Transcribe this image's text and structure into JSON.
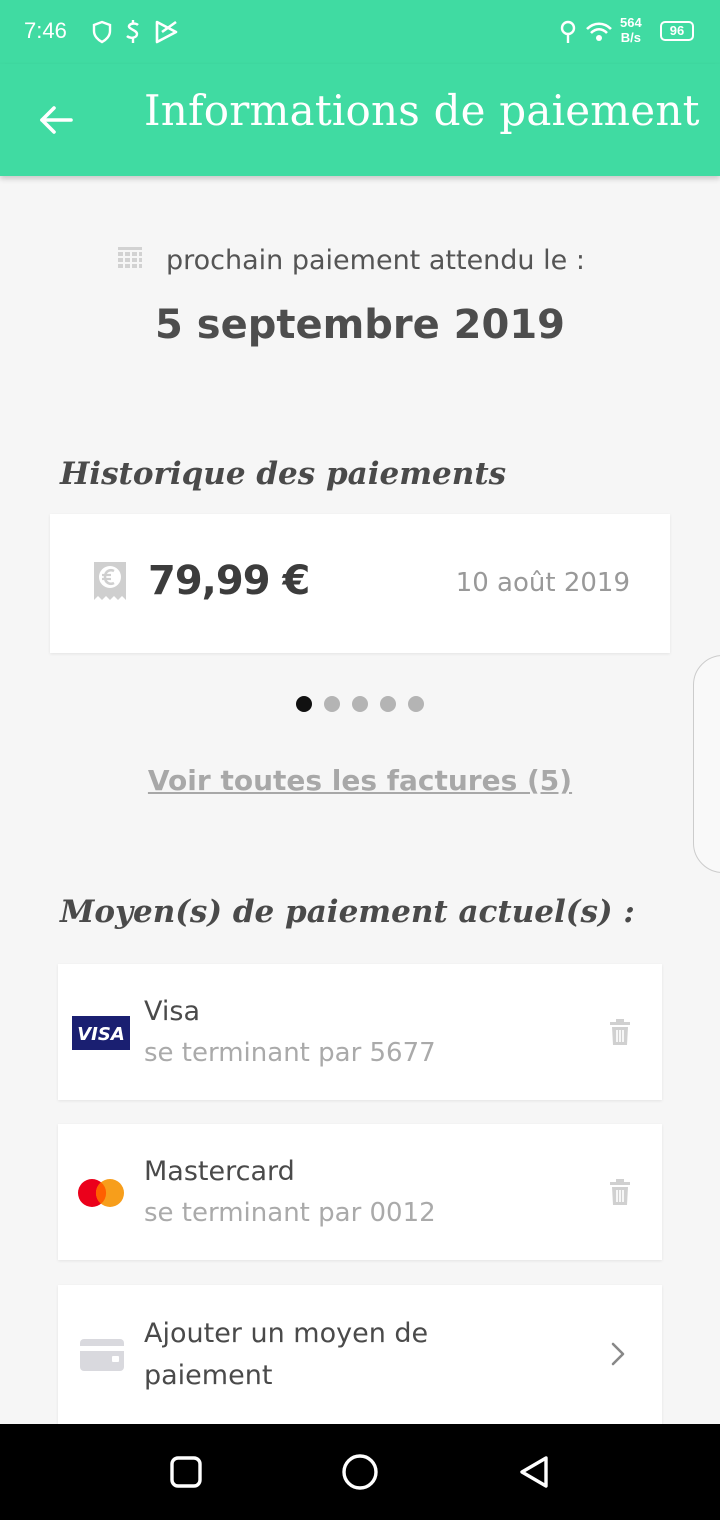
{
  "status_bar": {
    "time": "7:46",
    "net_speed_value": "564",
    "net_speed_unit": "B/s",
    "battery": "96",
    "icons": [
      "shield-icon",
      "dollar-icon",
      "play-store-icon",
      "location-pin-icon",
      "wifi-icon"
    ]
  },
  "app_bar": {
    "title": "Informations de paiement",
    "back_icon": "arrow-left-icon"
  },
  "next_payment": {
    "label": "prochain paiement attendu le :",
    "date": "5 septembre 2019",
    "icon": "calendar-icon"
  },
  "history": {
    "title": "Historique des paiements",
    "items": [
      {
        "amount": "79,99 €",
        "date": "10 août 2019",
        "icon": "euro-receipt-icon"
      }
    ],
    "pagination": {
      "total": 5,
      "active": 1
    },
    "see_all_label": "Voir toutes les factures (5)"
  },
  "payment_methods": {
    "title": "Moyen(s) de paiement actuel(s) :",
    "items": [
      {
        "name": "Visa",
        "detail": "se terminant par 5677",
        "logo": "visa-logo",
        "logo_text": "VISA"
      },
      {
        "name": "Mastercard",
        "detail": "se terminant par 0012",
        "logo": "mastercard-logo"
      }
    ],
    "add_label": "Ajouter un moyen de paiement"
  },
  "colors": {
    "brand_green": "#40dba2",
    "visa_blue": "#1a1f71",
    "mastercard_red": "#eb001b",
    "mastercard_orange": "#f79e1b"
  },
  "nav_bar": {
    "buttons": [
      "recents-square-icon",
      "home-circle-icon",
      "back-triangle-icon"
    ]
  }
}
